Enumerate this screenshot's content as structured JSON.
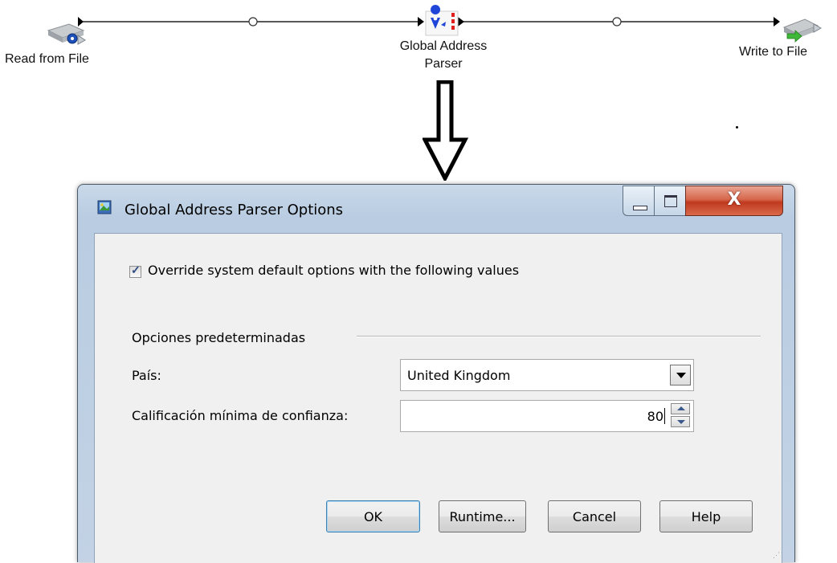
{
  "flow": {
    "nodes": [
      {
        "label": "Read from File",
        "icon": "read-file-stage-icon"
      },
      {
        "label": "Global Address\nParser",
        "icon": "address-parser-stage-icon"
      },
      {
        "label": "Write to File",
        "icon": "write-file-stage-icon"
      }
    ]
  },
  "dialog": {
    "title": "Global Address Parser Options",
    "close_glyph": "X",
    "override": {
      "checked": true,
      "label": "Override system default options with the following values"
    },
    "group_title": "Opciones predeterminadas",
    "country": {
      "label": "País:",
      "value": "United Kingdom"
    },
    "confidence": {
      "label": "Calificación mínima de confianza:",
      "value": "80"
    },
    "buttons": {
      "ok": "OK",
      "runtime": "Runtime...",
      "cancel": "Cancel",
      "help": "Help"
    }
  },
  "colors": {
    "titlebar": "#c9d9ea",
    "close_button": "#c0391f",
    "default_button_border": "#3c7fb1",
    "checkmark": "#2d4a82"
  }
}
